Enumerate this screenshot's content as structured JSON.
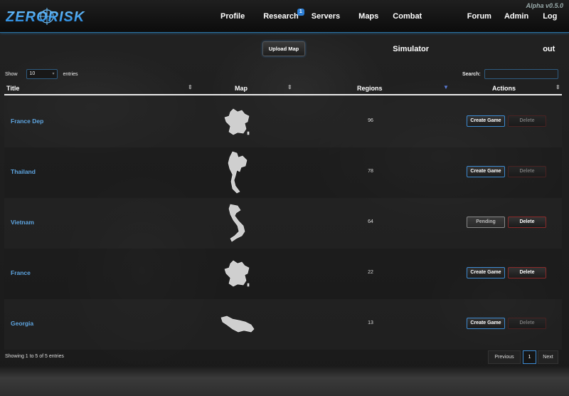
{
  "app": {
    "logo_text": "ZERORISK",
    "version": "Alpha v0.5.0",
    "brand_color": "#2e9bff"
  },
  "nav": {
    "items": [
      {
        "label": "Profile"
      },
      {
        "label": "Research",
        "badge": "1"
      },
      {
        "label": "Servers"
      },
      {
        "label": "Maps"
      },
      {
        "label": "Combat Simulator"
      },
      {
        "label": "Forum"
      },
      {
        "label": "Admin"
      },
      {
        "label": "Log out"
      }
    ]
  },
  "toolbar": {
    "upload_label": "Upload Map"
  },
  "table_controls": {
    "show_label": "Show",
    "entries_value": "10",
    "entries_label": "entries",
    "search_label": "Search:",
    "search_value": ""
  },
  "table": {
    "columns": [
      "Title",
      "Map",
      "Regions",
      "Actions"
    ],
    "rows": [
      {
        "title": "France Dep",
        "map_icon": "france-map-icon",
        "regions": "96",
        "primary_action": "Create Game",
        "delete_label": "Delete",
        "delete_enabled": false
      },
      {
        "title": "Thailand",
        "map_icon": "thailand-map-icon",
        "regions": "78",
        "primary_action": "Create Game",
        "delete_label": "Delete",
        "delete_enabled": false
      },
      {
        "title": "Vietnam",
        "map_icon": "vietnam-map-icon",
        "regions": "64",
        "primary_action": "Pending",
        "delete_label": "Delete",
        "delete_enabled": true
      },
      {
        "title": "France",
        "map_icon": "france-map-icon",
        "regions": "22",
        "primary_action": "Create Game",
        "delete_label": "Delete",
        "delete_enabled": true
      },
      {
        "title": "Georgia",
        "map_icon": "georgia-map-icon",
        "regions": "13",
        "primary_action": "Create Game",
        "delete_label": "Delete",
        "delete_enabled": false
      }
    ]
  },
  "footer": {
    "info": "Showing 1 to 5 of 5 entries",
    "prev_label": "Previous",
    "page": "1",
    "next_label": "Next"
  }
}
